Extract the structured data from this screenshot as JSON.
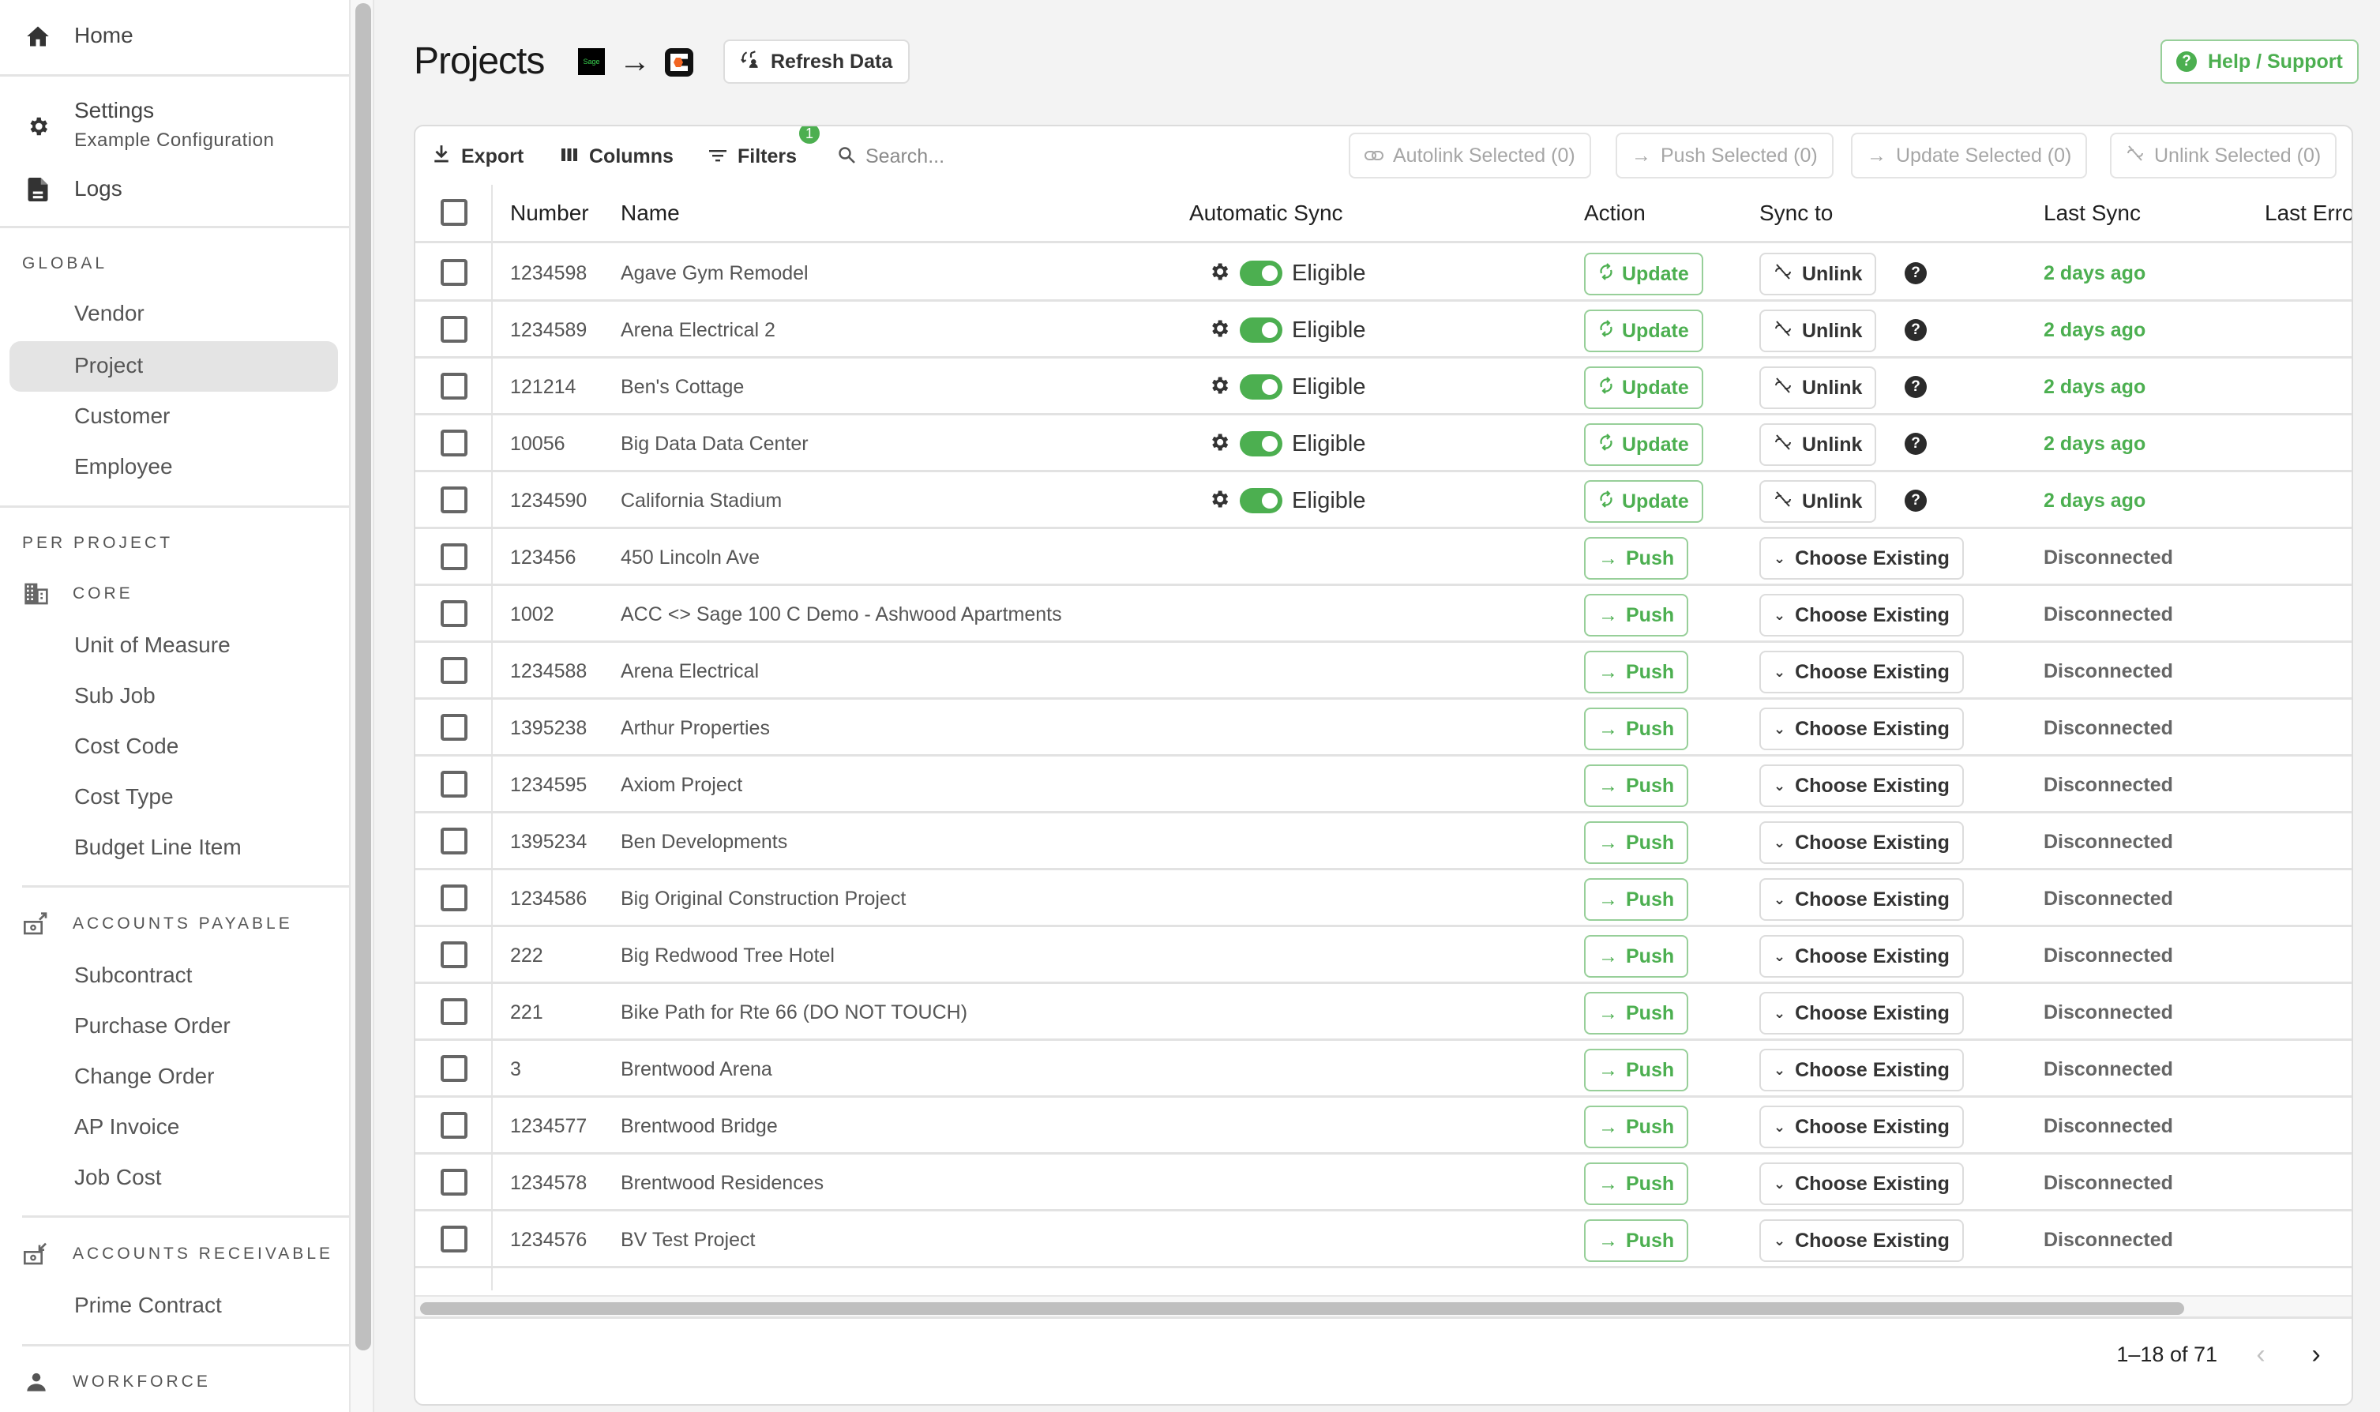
{
  "sidebar": {
    "home": {
      "label": "Home",
      "icon": "home-icon"
    },
    "settings": {
      "label": "Settings",
      "sublabel": "Example Configuration",
      "icon": "gear-icon"
    },
    "logs": {
      "label": "Logs",
      "icon": "file-icon"
    },
    "global": {
      "header": "GLOBAL",
      "items": [
        {
          "label": "Vendor",
          "active": false
        },
        {
          "label": "Project",
          "active": true
        },
        {
          "label": "Customer",
          "active": false
        },
        {
          "label": "Employee",
          "active": false
        }
      ]
    },
    "per_project": {
      "header": "PER PROJECT",
      "sections": [
        {
          "title": "CORE",
          "icon": "building-icon",
          "items": [
            "Unit of Measure",
            "Sub Job",
            "Cost Code",
            "Cost Type",
            "Budget Line Item"
          ]
        },
        {
          "title": "ACCOUNTS PAYABLE",
          "icon": "payment-out-icon",
          "items": [
            "Subcontract",
            "Purchase Order",
            "Change Order",
            "AP Invoice",
            "Job Cost"
          ]
        },
        {
          "title": "ACCOUNTS RECEIVABLE",
          "icon": "payment-in-icon",
          "items": [
            "Prime Contract"
          ]
        },
        {
          "title": "WORKFORCE",
          "icon": "person-icon",
          "items": []
        }
      ]
    }
  },
  "header": {
    "title": "Projects",
    "source_logo": "Sage",
    "refresh_label": "Refresh Data",
    "help_label": "Help / Support"
  },
  "toolbar": {
    "export_label": "Export",
    "columns_label": "Columns",
    "filters_label": "Filters",
    "filters_count": "1",
    "search_placeholder": "Search...",
    "search_value": "",
    "bulk": {
      "autolink": "Autolink Selected (0)",
      "push": "Push Selected (0)",
      "update": "Update Selected (0)",
      "unlink": "Unlink Selected (0)"
    }
  },
  "table": {
    "columns": {
      "number": "Number",
      "name": "Name",
      "auto_sync": "Automatic Sync",
      "action": "Action",
      "sync_to": "Sync to",
      "last_sync": "Last Sync",
      "last_error": "Last Erro"
    },
    "rows": [
      {
        "number": "1234598",
        "name": "Agave Gym Remodel",
        "auto_sync": "Eligible",
        "action": "Update",
        "sync_to": "Unlink",
        "last_sync": "2 days ago",
        "linked": true
      },
      {
        "number": "1234589",
        "name": "Arena Electrical 2",
        "auto_sync": "Eligible",
        "action": "Update",
        "sync_to": "Unlink",
        "last_sync": "2 days ago",
        "linked": true
      },
      {
        "number": "121214",
        "name": "Ben's Cottage",
        "auto_sync": "Eligible",
        "action": "Update",
        "sync_to": "Unlink",
        "last_sync": "2 days ago",
        "linked": true
      },
      {
        "number": "10056",
        "name": "Big Data Data Center",
        "auto_sync": "Eligible",
        "action": "Update",
        "sync_to": "Unlink",
        "last_sync": "2 days ago",
        "linked": true
      },
      {
        "number": "1234590",
        "name": "California Stadium",
        "auto_sync": "Eligible",
        "action": "Update",
        "sync_to": "Unlink",
        "last_sync": "2 days ago",
        "linked": true
      },
      {
        "number": "123456",
        "name": "450 Lincoln Ave",
        "auto_sync": "",
        "action": "Push",
        "sync_to": "Choose Existing",
        "last_sync": "Disconnected",
        "linked": false
      },
      {
        "number": "1002",
        "name": "ACC <> Sage 100 C Demo - Ashwood Apartments",
        "auto_sync": "",
        "action": "Push",
        "sync_to": "Choose Existing",
        "last_sync": "Disconnected",
        "linked": false
      },
      {
        "number": "1234588",
        "name": "Arena Electrical",
        "auto_sync": "",
        "action": "Push",
        "sync_to": "Choose Existing",
        "last_sync": "Disconnected",
        "linked": false
      },
      {
        "number": "1395238",
        "name": "Arthur Properties",
        "auto_sync": "",
        "action": "Push",
        "sync_to": "Choose Existing",
        "last_sync": "Disconnected",
        "linked": false
      },
      {
        "number": "1234595",
        "name": "Axiom Project",
        "auto_sync": "",
        "action": "Push",
        "sync_to": "Choose Existing",
        "last_sync": "Disconnected",
        "linked": false
      },
      {
        "number": "1395234",
        "name": "Ben Developments",
        "auto_sync": "",
        "action": "Push",
        "sync_to": "Choose Existing",
        "last_sync": "Disconnected",
        "linked": false
      },
      {
        "number": "1234586",
        "name": "Big Original Construction Project",
        "auto_sync": "",
        "action": "Push",
        "sync_to": "Choose Existing",
        "last_sync": "Disconnected",
        "linked": false
      },
      {
        "number": "222",
        "name": "Big Redwood Tree Hotel",
        "auto_sync": "",
        "action": "Push",
        "sync_to": "Choose Existing",
        "last_sync": "Disconnected",
        "linked": false
      },
      {
        "number": "221",
        "name": "Bike Path for Rte 66 (DO NOT TOUCH)",
        "auto_sync": "",
        "action": "Push",
        "sync_to": "Choose Existing",
        "last_sync": "Disconnected",
        "linked": false
      },
      {
        "number": "3",
        "name": "Brentwood Arena",
        "auto_sync": "",
        "action": "Push",
        "sync_to": "Choose Existing",
        "last_sync": "Disconnected",
        "linked": false
      },
      {
        "number": "1234577",
        "name": "Brentwood Bridge",
        "auto_sync": "",
        "action": "Push",
        "sync_to": "Choose Existing",
        "last_sync": "Disconnected",
        "linked": false
      },
      {
        "number": "1234578",
        "name": "Brentwood Residences",
        "auto_sync": "",
        "action": "Push",
        "sync_to": "Choose Existing",
        "last_sync": "Disconnected",
        "linked": false
      },
      {
        "number": "1234576",
        "name": "BV Test Project",
        "auto_sync": "",
        "action": "Push",
        "sync_to": "Choose Existing",
        "last_sync": "Disconnected",
        "linked": false
      }
    ]
  },
  "pagination": {
    "range_label": "1–18 of 71",
    "prev_enabled": false,
    "next_enabled": true
  },
  "colors": {
    "accent_green": "#4caf50",
    "green_border": "#97cf99",
    "selected_bg": "#e4e4e4",
    "disconnected_text": "#666666"
  }
}
